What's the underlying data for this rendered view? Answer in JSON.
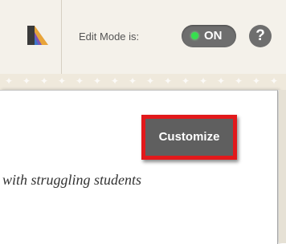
{
  "header": {
    "color_picker_icon": "color-palette-icon",
    "edit_mode_label": "Edit Mode is:",
    "edit_mode_toggle": {
      "text": "ON",
      "state": "on",
      "indicator_color": "#36e04e"
    },
    "help_icon": {
      "name": "help-icon",
      "glyph": "?"
    }
  },
  "content": {
    "customize_button_label": "Customize",
    "highlight_color": "#e2191b",
    "body_text": "with struggling students"
  }
}
